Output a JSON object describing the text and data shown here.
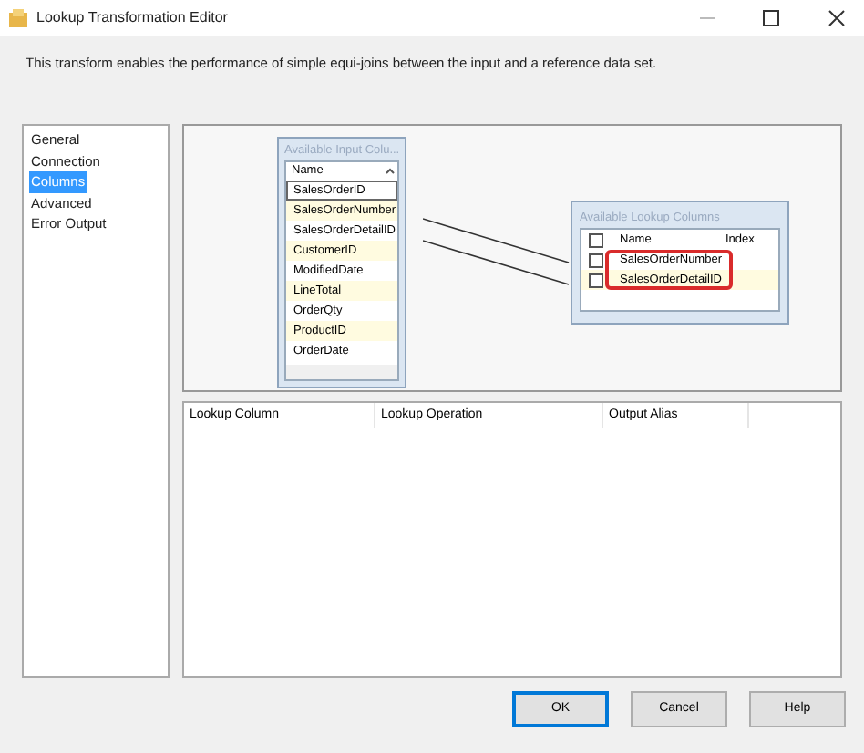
{
  "window": {
    "title": "Lookup Transformation Editor"
  },
  "description": "This transform enables the performance of simple equi-joins between the input and a reference data set.",
  "nav": [
    {
      "label": "General",
      "selected": false
    },
    {
      "label": "Connection",
      "selected": false
    },
    {
      "label": "Columns",
      "selected": true
    },
    {
      "label": "Advanced",
      "selected": false
    },
    {
      "label": "Error Output",
      "selected": false
    }
  ],
  "input_columns": {
    "title": "Available Input Colu...",
    "header": "Name",
    "rows": [
      {
        "name": "SalesOrderID",
        "focused": true
      },
      {
        "name": "SalesOrderNumber",
        "focused": false
      },
      {
        "name": "SalesOrderDetailID",
        "focused": false
      },
      {
        "name": "CustomerID",
        "focused": false
      },
      {
        "name": "ModifiedDate",
        "focused": false
      },
      {
        "name": "LineTotal",
        "focused": false
      },
      {
        "name": "OrderQty",
        "focused": false
      },
      {
        "name": "ProductID",
        "focused": false
      },
      {
        "name": "OrderDate",
        "focused": false
      }
    ]
  },
  "lookup_columns": {
    "title": "Available Lookup Columns",
    "header_name": "Name",
    "header_index": "Index",
    "header_checked": false,
    "rows": [
      {
        "name": "SalesOrderNumber",
        "checked": false
      },
      {
        "name": "SalesOrderDetailID",
        "checked": false
      }
    ]
  },
  "mapping_grid": {
    "columns": [
      "Lookup Column",
      "Lookup Operation",
      "Output Alias"
    ]
  },
  "buttons": [
    {
      "label": "OK",
      "default": true
    },
    {
      "label": "Cancel",
      "default": false
    },
    {
      "label": "Help",
      "default": false
    }
  ]
}
